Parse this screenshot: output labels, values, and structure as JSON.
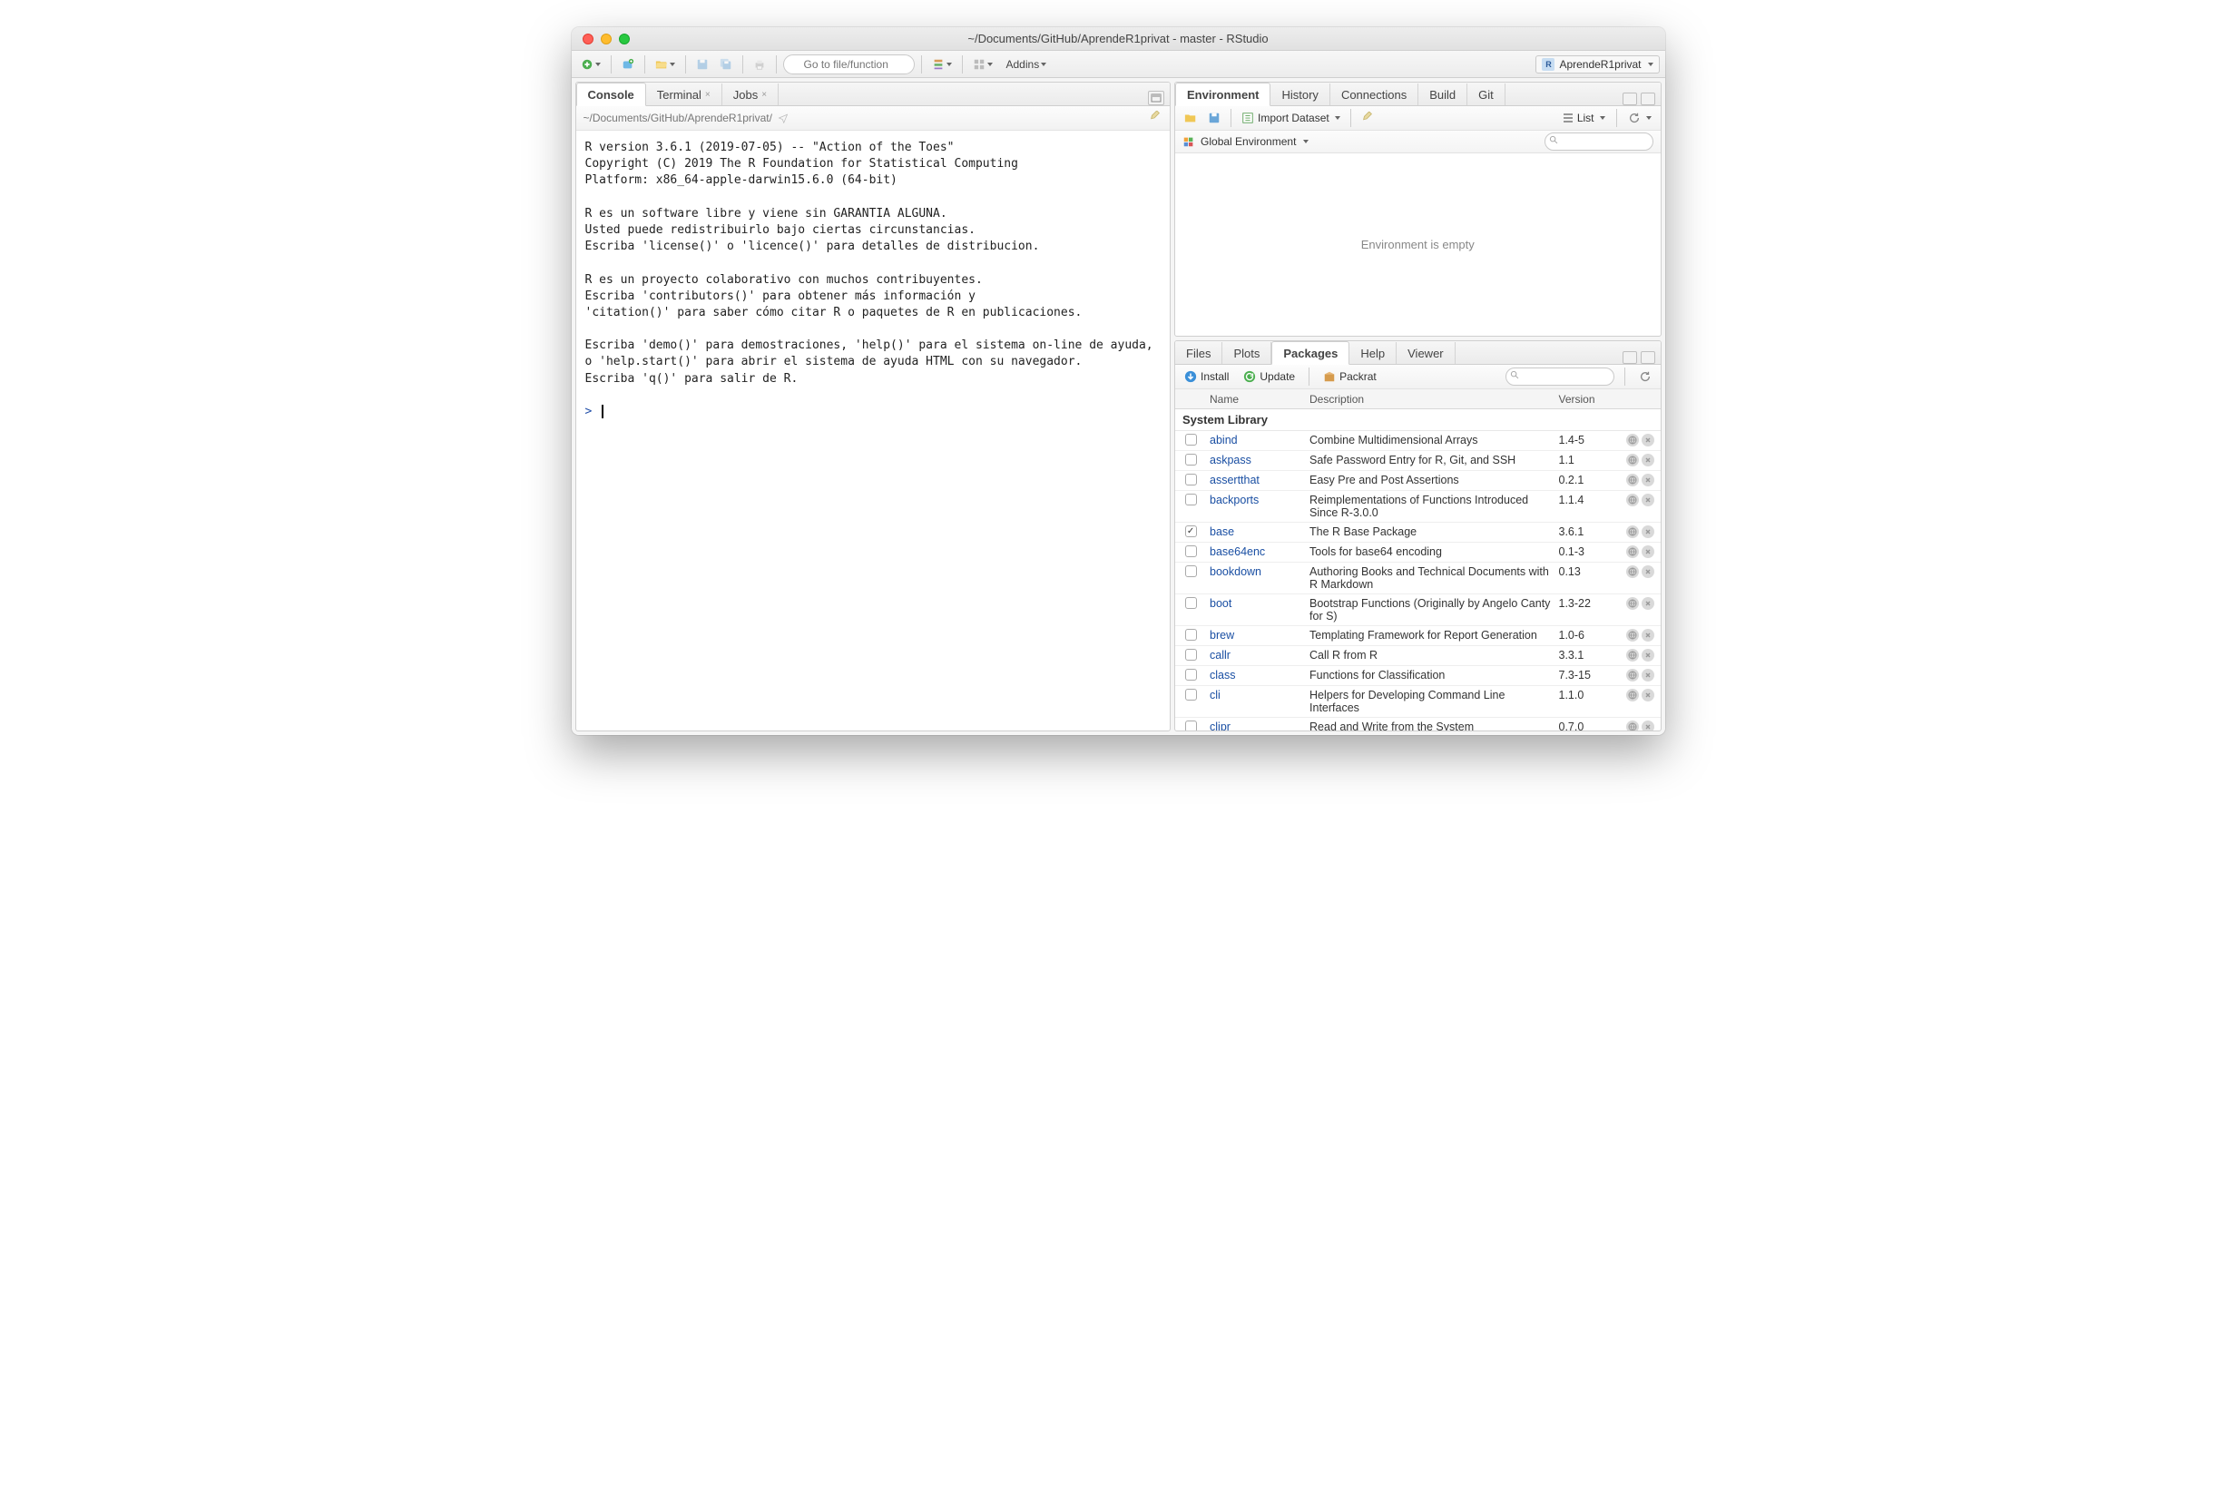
{
  "window": {
    "title": "~/Documents/GitHub/AprendeR1privat - master - RStudio"
  },
  "toolbar": {
    "goto_placeholder": "Go to file/function",
    "addins_label": "Addins",
    "project_name": "AprendeR1privat"
  },
  "left_pane": {
    "tabs": [
      "Console",
      "Terminal",
      "Jobs"
    ],
    "active_tab": 0,
    "path": "~/Documents/GitHub/AprendeR1privat/",
    "console_text": "R version 3.6.1 (2019-07-05) -- \"Action of the Toes\"\nCopyright (C) 2019 The R Foundation for Statistical Computing\nPlatform: x86_64-apple-darwin15.6.0 (64-bit)\n\nR es un software libre y viene sin GARANTIA ALGUNA.\nUsted puede redistribuirlo bajo ciertas circunstancias.\nEscriba 'license()' o 'licence()' para detalles de distribucion.\n\nR es un proyecto colaborativo con muchos contribuyentes.\nEscriba 'contributors()' para obtener más información y\n'citation()' para saber cómo citar R o paquetes de R en publicaciones.\n\nEscriba 'demo()' para demostraciones, 'help()' para el sistema on-line de ayuda,\no 'help.start()' para abrir el sistema de ayuda HTML con su navegador.\nEscriba 'q()' para salir de R.\n",
    "prompt": ">"
  },
  "env_pane": {
    "tabs": [
      "Environment",
      "History",
      "Connections",
      "Build",
      "Git"
    ],
    "active_tab": 0,
    "import_label": "Import Dataset",
    "list_label": "List",
    "scope_label": "Global Environment",
    "empty_label": "Environment is empty"
  },
  "pkg_pane": {
    "tabs": [
      "Files",
      "Plots",
      "Packages",
      "Help",
      "Viewer"
    ],
    "active_tab": 2,
    "install_label": "Install",
    "update_label": "Update",
    "packrat_label": "Packrat",
    "columns": {
      "name": "Name",
      "desc": "Description",
      "ver": "Version"
    },
    "section": "System Library",
    "packages": [
      {
        "checked": false,
        "name": "abind",
        "desc": "Combine Multidimensional Arrays",
        "ver": "1.4-5"
      },
      {
        "checked": false,
        "name": "askpass",
        "desc": "Safe Password Entry for R, Git, and SSH",
        "ver": "1.1"
      },
      {
        "checked": false,
        "name": "assertthat",
        "desc": "Easy Pre and Post Assertions",
        "ver": "0.2.1"
      },
      {
        "checked": false,
        "name": "backports",
        "desc": "Reimplementations of Functions Introduced Since R-3.0.0",
        "ver": "1.1.4"
      },
      {
        "checked": true,
        "name": "base",
        "desc": "The R Base Package",
        "ver": "3.6.1"
      },
      {
        "checked": false,
        "name": "base64enc",
        "desc": "Tools for base64 encoding",
        "ver": "0.1-3"
      },
      {
        "checked": false,
        "name": "bookdown",
        "desc": "Authoring Books and Technical Documents with R Markdown",
        "ver": "0.13"
      },
      {
        "checked": false,
        "name": "boot",
        "desc": "Bootstrap Functions (Originally by Angelo Canty for S)",
        "ver": "1.3-22"
      },
      {
        "checked": false,
        "name": "brew",
        "desc": "Templating Framework for Report Generation",
        "ver": "1.0-6"
      },
      {
        "checked": false,
        "name": "callr",
        "desc": "Call R from R",
        "ver": "3.3.1"
      },
      {
        "checked": false,
        "name": "class",
        "desc": "Functions for Classification",
        "ver": "7.3-15"
      },
      {
        "checked": false,
        "name": "cli",
        "desc": "Helpers for Developing Command Line Interfaces",
        "ver": "1.1.0"
      },
      {
        "checked": false,
        "name": "clipr",
        "desc": "Read and Write from the System",
        "ver": "0.7.0"
      }
    ]
  }
}
